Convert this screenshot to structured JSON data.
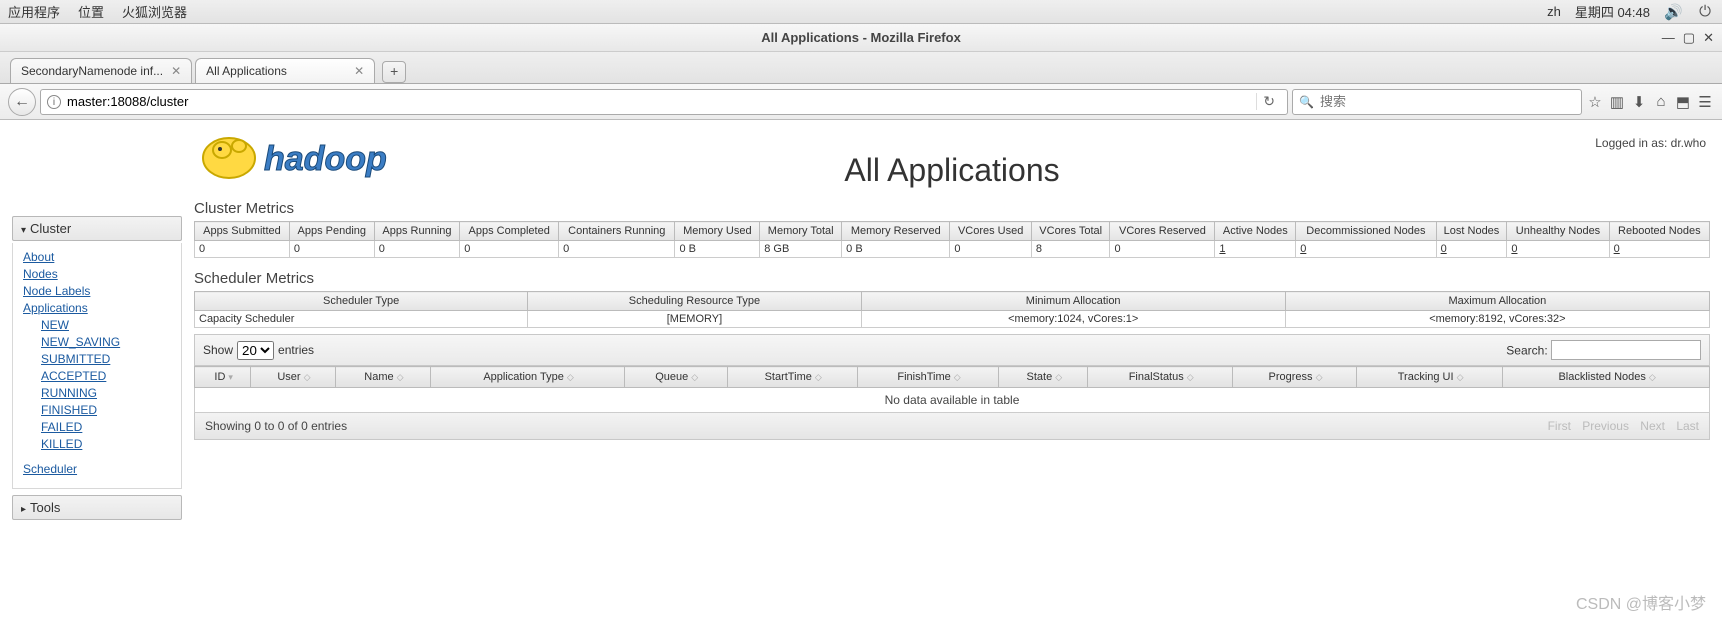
{
  "desktop": {
    "menu_apps": "应用程序",
    "menu_places": "位置",
    "menu_firefox": "火狐浏览器",
    "lang": "zh",
    "clock": "星期四 04:48"
  },
  "window": {
    "title": "All Applications - Mozilla Firefox"
  },
  "tabs": {
    "t0": "SecondaryNamenode inf...",
    "t1": "All Applications"
  },
  "urlbar": {
    "value": "master:18088/cluster"
  },
  "searchbar": {
    "placeholder": "搜索"
  },
  "login": "Logged in as: dr.who",
  "page_title": "All Applications",
  "sidebar": {
    "cluster": "Cluster",
    "about": "About",
    "nodes": "Nodes",
    "node_labels": "Node Labels",
    "applications": "Applications",
    "new": "NEW",
    "new_saving": "NEW_SAVING",
    "submitted": "SUBMITTED",
    "accepted": "ACCEPTED",
    "running": "RUNNING",
    "finished": "FINISHED",
    "failed": "FAILED",
    "killed": "KILLED",
    "scheduler": "Scheduler",
    "tools": "Tools"
  },
  "sections": {
    "cluster_metrics": "Cluster Metrics",
    "scheduler_metrics": "Scheduler Metrics"
  },
  "cm": {
    "h": {
      "apps_submitted": "Apps Submitted",
      "apps_pending": "Apps Pending",
      "apps_running": "Apps Running",
      "apps_completed": "Apps Completed",
      "containers_running": "Containers Running",
      "memory_used": "Memory Used",
      "memory_total": "Memory Total",
      "memory_reserved": "Memory Reserved",
      "vcores_used": "VCores Used",
      "vcores_total": "VCores Total",
      "vcores_reserved": "VCores Reserved",
      "active_nodes": "Active Nodes",
      "decommissioned_nodes": "Decommissioned Nodes",
      "lost_nodes": "Lost Nodes",
      "unhealthy_nodes": "Unhealthy Nodes",
      "rebooted_nodes": "Rebooted Nodes"
    },
    "v": {
      "apps_submitted": "0",
      "apps_pending": "0",
      "apps_running": "0",
      "apps_completed": "0",
      "containers_running": "0",
      "memory_used": "0 B",
      "memory_total": "8 GB",
      "memory_reserved": "0 B",
      "vcores_used": "0",
      "vcores_total": "8",
      "vcores_reserved": "0",
      "active_nodes": "1",
      "decommissioned_nodes": "0",
      "lost_nodes": "0",
      "unhealthy_nodes": "0",
      "rebooted_nodes": "0"
    }
  },
  "sm": {
    "h": {
      "type": "Scheduler Type",
      "resource": "Scheduling Resource Type",
      "min": "Minimum Allocation",
      "max": "Maximum Allocation"
    },
    "v": {
      "type": "Capacity Scheduler",
      "resource": "[MEMORY]",
      "min": "<memory:1024, vCores:1>",
      "max": "<memory:8192, vCores:32>"
    }
  },
  "dt": {
    "show_label": "Show",
    "entries_label": "entries",
    "show_value": "20",
    "search_label": "Search:",
    "h": {
      "id": "ID",
      "user": "User",
      "name": "Name",
      "app_type": "Application Type",
      "queue": "Queue",
      "start": "StartTime",
      "finish": "FinishTime",
      "state": "State",
      "final": "FinalStatus",
      "progress": "Progress",
      "tracking": "Tracking UI",
      "blacklist": "Blacklisted Nodes"
    },
    "nodata": "No data available in table",
    "info": "Showing 0 to 0 of 0 entries",
    "first": "First",
    "prev": "Previous",
    "next": "Next",
    "last": "Last"
  },
  "watermark": "CSDN @博客小梦"
}
